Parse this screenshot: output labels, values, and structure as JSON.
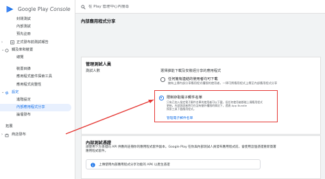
{
  "brand": {
    "name_prefix": "Google Play",
    "name_suffix": "Console"
  },
  "search": {
    "placeholder": "在 Play 管理中心內搜尋"
  },
  "sidebar": {
    "items": [
      {
        "label": "封閉測試"
      },
      {
        "label": "內部測試"
      },
      {
        "label": "預先註冊"
      },
      {
        "label": "正式發布前測試報告"
      },
      {
        "label": "觸及率和裝置"
      },
      {
        "label": "總覽"
      },
      {
        "label": "裝置目錄"
      },
      {
        "label": "應用程式套件探索工具"
      },
      {
        "label": "應用程式完整性"
      },
      {
        "label": "設定"
      },
      {
        "label": "進階設定"
      },
      {
        "label": "內部應用程式分享"
      },
      {
        "label": "論壇發布"
      },
      {
        "label": "拓展"
      },
      {
        "label": "商店發布"
      }
    ]
  },
  "page": {
    "title": "內部應用程式分享"
  },
  "testers_card": {
    "title": "管理測試人員",
    "label": "測試人數",
    "description": "選擇誰能下載及安裝經分享的應用程式",
    "option1_label": "任何擁有連結的使用者均可下載",
    "option1_sub": "擁有上傳內部分享應用程式權限的使用者，一律可將應用程式上傳至內部應用程式分享",
    "option2_label": "限制存取電子郵件名單",
    "option2_desc_lines": [
      "只有已加入指定電子郵件名單的使用者可以下載，但任何使用者都能上傳應用程式",
      "更新。內部測試者將可在沒有額外權限的情況下，透過 App Bundle",
      "探索工具下載應用程式。"
    ],
    "manage_link": "管理電子郵件名單"
  },
  "cert_card": {
    "title": "內部測試憑證",
    "description_lines": [
      "請使用下方憑證向 API 供應商註冊你的應用程式套件副本。Google Play 在你與內部測試人員發布應用程式前，會使用這個憑證重新簽署",
      "應用程式套件。"
    ],
    "info_text": "上傳使用內部應用程式分享功能的 APK 以產生憑證"
  },
  "colors": {
    "accent": "#1a73e8",
    "highlight": "#e53935"
  }
}
